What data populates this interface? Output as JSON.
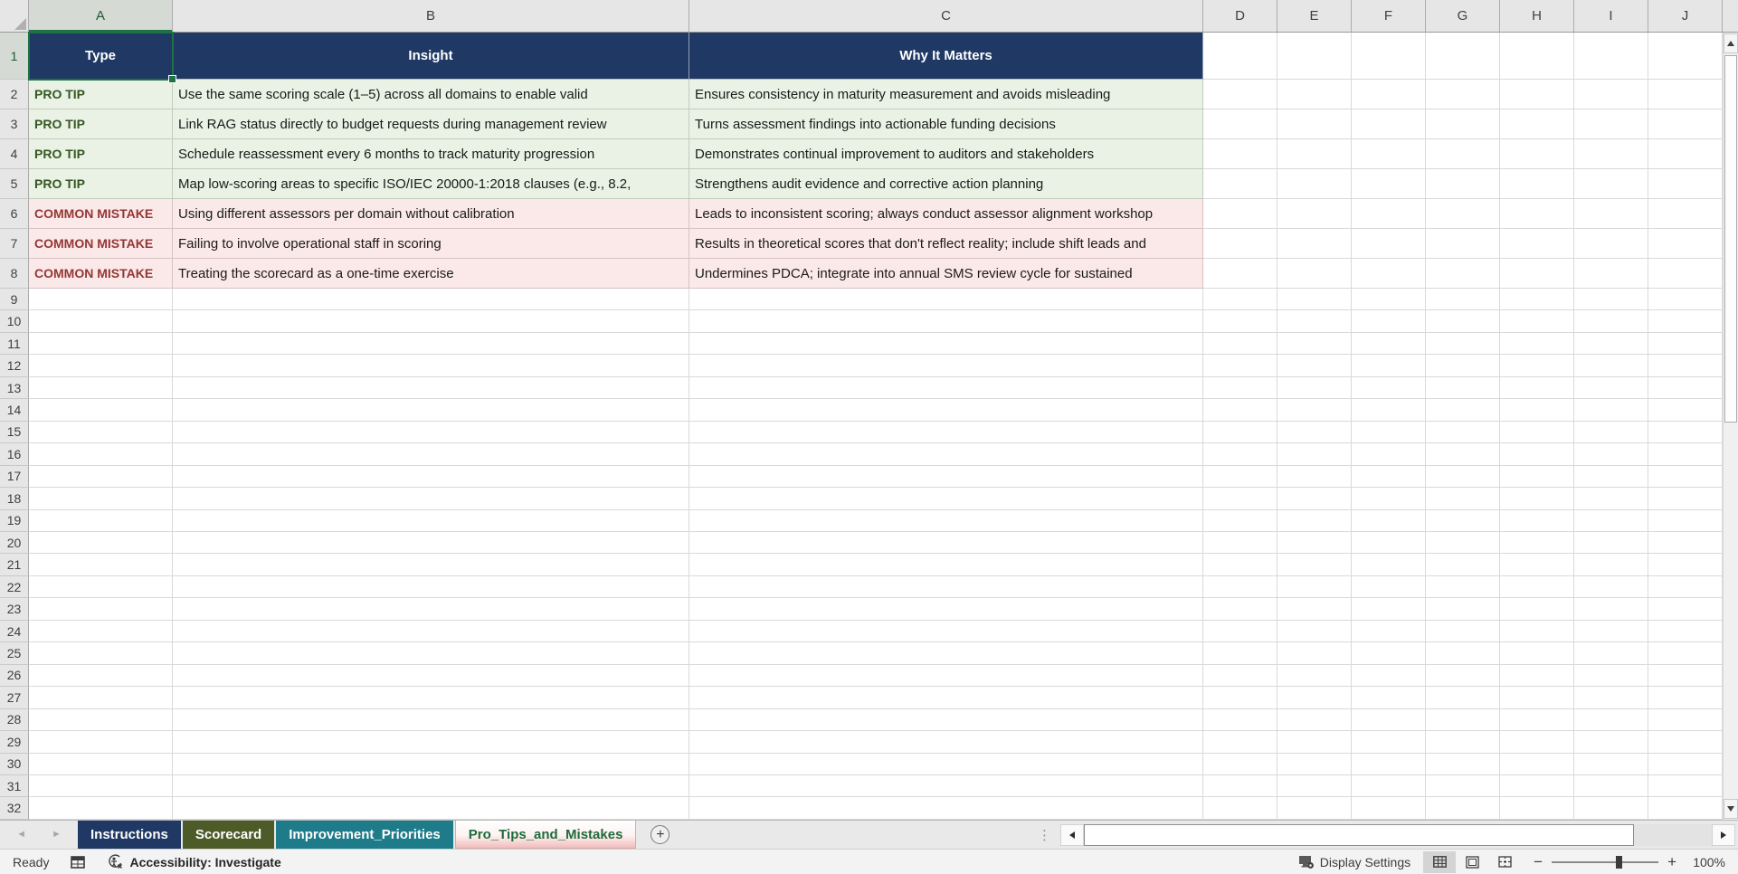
{
  "sheet": {
    "column_letters": [
      "A",
      "B",
      "C",
      "D",
      "E",
      "F",
      "G",
      "H",
      "I",
      "J"
    ],
    "visible_rows": 32,
    "selected_cell": "A1",
    "header_cells": [
      "Type",
      "Insight",
      "Why It Matters"
    ],
    "data_rows": [
      {
        "row": 2,
        "kind": "tip",
        "type": "PRO TIP",
        "insight": "Use the same scoring scale (1–5) across all domains to enable valid",
        "why": "Ensures consistency in maturity measurement and avoids misleading"
      },
      {
        "row": 3,
        "kind": "tip",
        "type": "PRO TIP",
        "insight": "Link RAG status directly to budget requests during management review",
        "why": "Turns assessment findings into actionable funding decisions"
      },
      {
        "row": 4,
        "kind": "tip",
        "type": "PRO TIP",
        "insight": "Schedule reassessment every 6 months to track maturity progression",
        "why": "Demonstrates continual improvement to auditors and stakeholders"
      },
      {
        "row": 5,
        "kind": "tip",
        "type": "PRO TIP",
        "insight": "Map low-scoring areas to specific ISO/IEC 20000-1:2018 clauses (e.g., 8.2,",
        "why": "Strengthens audit evidence and corrective action planning"
      },
      {
        "row": 6,
        "kind": "mistake",
        "type": "COMMON MISTAKE",
        "insight": "Using different assessors per domain without calibration",
        "why": "Leads to inconsistent scoring; always conduct assessor alignment workshop"
      },
      {
        "row": 7,
        "kind": "mistake",
        "type": "COMMON MISTAKE",
        "insight": "Failing to involve operational staff in scoring",
        "why": "Results in theoretical scores that don't reflect reality; include shift leads and"
      },
      {
        "row": 8,
        "kind": "mistake",
        "type": "COMMON MISTAKE",
        "insight": "Treating the scorecard as a one-time exercise",
        "why": "Undermines PDCA; integrate into annual SMS review cycle for sustained"
      }
    ]
  },
  "tabs": [
    {
      "label": "Instructions",
      "style": "navy",
      "active": false
    },
    {
      "label": "Scorecard",
      "style": "olive",
      "active": false
    },
    {
      "label": "Improvement_Priorities",
      "style": "teal",
      "active": false
    },
    {
      "label": "Pro_Tips_and_Mistakes",
      "style": "active",
      "active": true
    }
  ],
  "statusbar": {
    "ready": "Ready",
    "accessibility": "Accessibility: Investigate",
    "display_settings": "Display Settings",
    "zoom_level": "100%"
  },
  "icons": {
    "select_all": "select-all-triangle",
    "sheet_nav_prev": "chevron-left",
    "sheet_nav_next": "chevron-right",
    "add_sheet": "plus-circle",
    "macro_record": "macro-grid",
    "accessibility": "accessibility-person",
    "display_settings": "monitor-gear",
    "view_normal": "grid",
    "view_page_layout": "page",
    "view_page_break": "page-break",
    "zoom_out": "minus",
    "zoom_in": "plus"
  },
  "colors": {
    "header_fill": "#1F3864",
    "header_text": "#FFFFFF",
    "tip_bg": "#E9F2E4",
    "tip_text": "#375623",
    "mistake_bg": "#FBE9E9",
    "mistake_text": "#943634",
    "selection_green": "#1E7145",
    "tab_instructions": "#1F3864",
    "tab_scorecard": "#4C5B28",
    "tab_improvement": "#1E7C8A",
    "active_tab_text": "#1E6B3A"
  }
}
